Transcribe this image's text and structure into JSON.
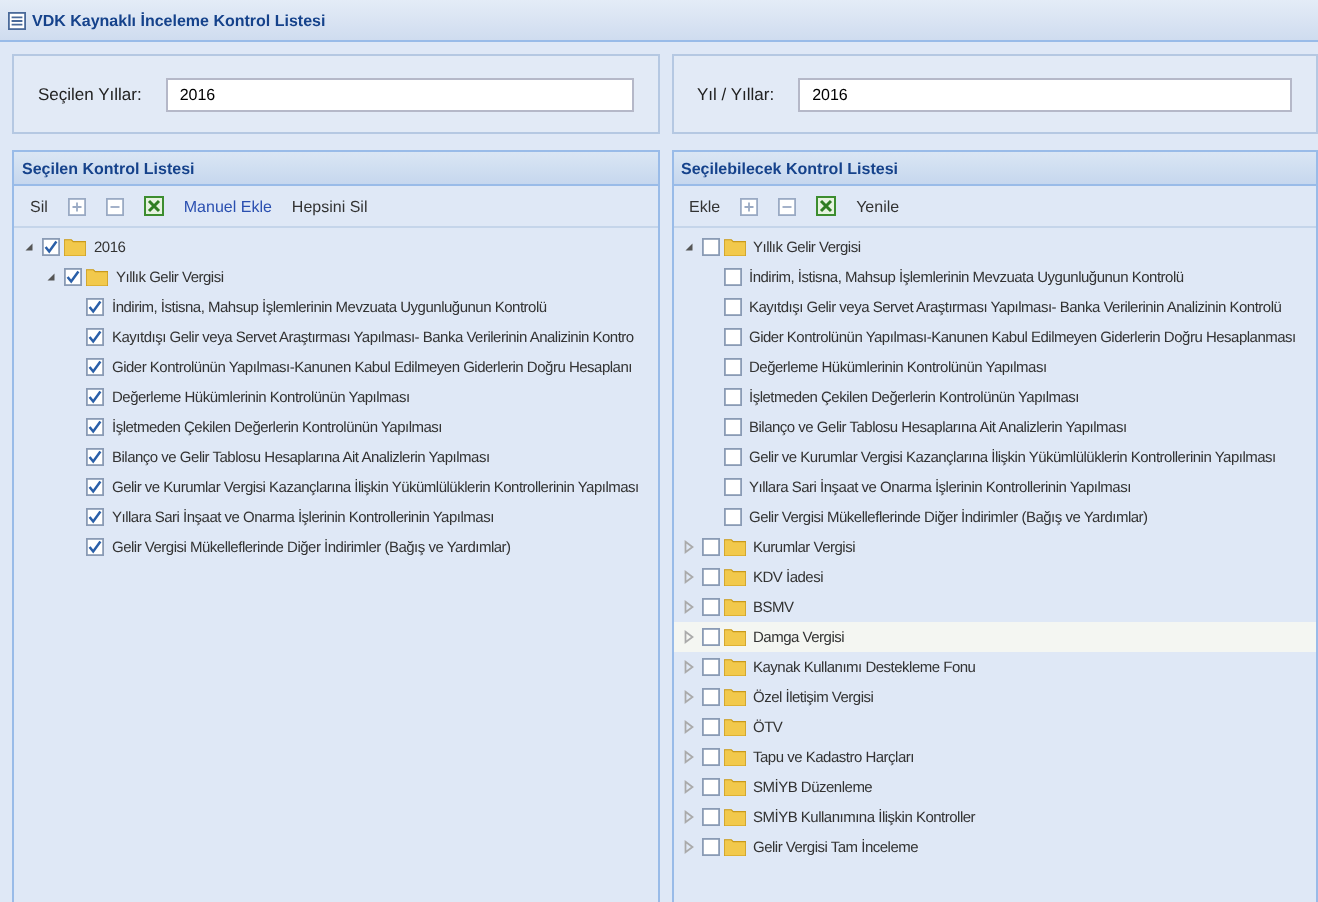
{
  "window": {
    "title": "VDK Kaynaklı İnceleme Kontrol Listesi"
  },
  "panels": [
    {
      "year_label": "Seçilen Yıllar:",
      "year_value": "2016",
      "title": "Seçilen Kontrol Listesi",
      "toolbar": [
        {
          "kind": "text",
          "label": "Sil"
        },
        {
          "kind": "expand"
        },
        {
          "kind": "collapse"
        },
        {
          "kind": "excel"
        },
        {
          "kind": "link",
          "label": "Manuel Ekle"
        },
        {
          "kind": "text",
          "label": "Hepsini Sil"
        }
      ],
      "tree": [
        {
          "label": "2016",
          "folder": true,
          "checked": true,
          "expanded": true,
          "selected": false,
          "children": [
            {
              "label": "Yıllık Gelir Vergisi",
              "folder": true,
              "checked": true,
              "expanded": true,
              "selected": false,
              "children": [
                {
                  "label": "İndirim, İstisna, Mahsup İşlemlerinin Mevzuata Uygunluğunun Kontrolü",
                  "folder": false,
                  "checked": true,
                  "selected": false
                },
                {
                  "label": "Kayıtdışı Gelir veya Servet Araştırması Yapılması- Banka Verilerinin Analizinin Kontro",
                  "folder": false,
                  "checked": true,
                  "selected": false
                },
                {
                  "label": "Gider Kontrolünün Yapılması-Kanunen Kabul Edilmeyen Giderlerin Doğru Hesaplanı",
                  "folder": false,
                  "checked": true,
                  "selected": false
                },
                {
                  "label": "Değerleme Hükümlerinin Kontrolünün Yapılması",
                  "folder": false,
                  "checked": true,
                  "selected": false
                },
                {
                  "label": "İşletmeden Çekilen Değerlerin Kontrolünün Yapılması",
                  "folder": false,
                  "checked": true,
                  "selected": false
                },
                {
                  "label": "Bilanço ve Gelir Tablosu Hesaplarına Ait Analizlerin Yapılması",
                  "folder": false,
                  "checked": true,
                  "selected": false
                },
                {
                  "label": "Gelir ve Kurumlar Vergisi Kazançlarına İlişkin Yükümlülüklerin Kontrollerinin Yapılması",
                  "folder": false,
                  "checked": true,
                  "selected": false
                },
                {
                  "label": "Yıllara Sari İnşaat ve Onarma İşlerinin Kontrollerinin Yapılması",
                  "folder": false,
                  "checked": true,
                  "selected": false
                },
                {
                  "label": "Gelir Vergisi Mükelleflerinde Diğer İndirimler (Bağış ve Yardımlar)",
                  "folder": false,
                  "checked": true,
                  "selected": false
                }
              ]
            }
          ]
        }
      ]
    },
    {
      "year_label": "Yıl / Yıllar:",
      "year_value": "2016",
      "title": "Seçilebilecek Kontrol Listesi",
      "toolbar": [
        {
          "kind": "text",
          "label": "Ekle"
        },
        {
          "kind": "expand"
        },
        {
          "kind": "collapse"
        },
        {
          "kind": "excel"
        },
        {
          "kind": "text",
          "label": "Yenile"
        }
      ],
      "tree": [
        {
          "label": "Yıllık Gelir Vergisi",
          "folder": true,
          "checked": false,
          "expanded": true,
          "selected": false,
          "children": [
            {
              "label": "İndirim, İstisna, Mahsup İşlemlerinin Mevzuata Uygunluğunun Kontrolü",
              "folder": false,
              "checked": false,
              "selected": false
            },
            {
              "label": "Kayıtdışı Gelir veya Servet Araştırması Yapılması- Banka Verilerinin Analizinin Kontrolü",
              "folder": false,
              "checked": false,
              "selected": false
            },
            {
              "label": "Gider Kontrolünün Yapılması-Kanunen Kabul Edilmeyen Giderlerin Doğru Hesaplanması",
              "folder": false,
              "checked": false,
              "selected": false
            },
            {
              "label": "Değerleme Hükümlerinin Kontrolünün Yapılması",
              "folder": false,
              "checked": false,
              "selected": false
            },
            {
              "label": "İşletmeden Çekilen Değerlerin Kontrolünün Yapılması",
              "folder": false,
              "checked": false,
              "selected": false
            },
            {
              "label": "Bilanço ve Gelir Tablosu Hesaplarına Ait Analizlerin Yapılması",
              "folder": false,
              "checked": false,
              "selected": false
            },
            {
              "label": "Gelir ve Kurumlar Vergisi Kazançlarına İlişkin Yükümlülüklerin Kontrollerinin Yapılması",
              "folder": false,
              "checked": false,
              "selected": false
            },
            {
              "label": "Yıllara Sari İnşaat ve Onarma İşlerinin Kontrollerinin Yapılması",
              "folder": false,
              "checked": false,
              "selected": false
            },
            {
              "label": "Gelir Vergisi Mükelleflerinde Diğer İndirimler (Bağış ve Yardımlar)",
              "folder": false,
              "checked": false,
              "selected": false
            }
          ]
        },
        {
          "label": "Kurumlar Vergisi",
          "folder": true,
          "checked": false,
          "expanded": false,
          "selected": false
        },
        {
          "label": "KDV İadesi",
          "folder": true,
          "checked": false,
          "expanded": false,
          "selected": false
        },
        {
          "label": "BSMV",
          "folder": true,
          "checked": false,
          "expanded": false,
          "selected": false
        },
        {
          "label": "Damga Vergisi",
          "folder": true,
          "checked": false,
          "expanded": false,
          "selected": true
        },
        {
          "label": "Kaynak Kullanımı Destekleme Fonu",
          "folder": true,
          "checked": false,
          "expanded": false,
          "selected": false
        },
        {
          "label": "Özel İletişim Vergisi",
          "folder": true,
          "checked": false,
          "expanded": false,
          "selected": false
        },
        {
          "label": "ÖTV",
          "folder": true,
          "checked": false,
          "expanded": false,
          "selected": false
        },
        {
          "label": "Tapu ve Kadastro Harçları",
          "folder": true,
          "checked": false,
          "expanded": false,
          "selected": false
        },
        {
          "label": "SMİYB Düzenleme",
          "folder": true,
          "checked": false,
          "expanded": false,
          "selected": false
        },
        {
          "label": "SMİYB Kullanımına İlişkin Kontroller",
          "folder": true,
          "checked": false,
          "expanded": false,
          "selected": false
        },
        {
          "label": "Gelir Vergisi Tam İnceleme",
          "folder": true,
          "checked": false,
          "expanded": false,
          "selected": false
        }
      ]
    }
  ]
}
